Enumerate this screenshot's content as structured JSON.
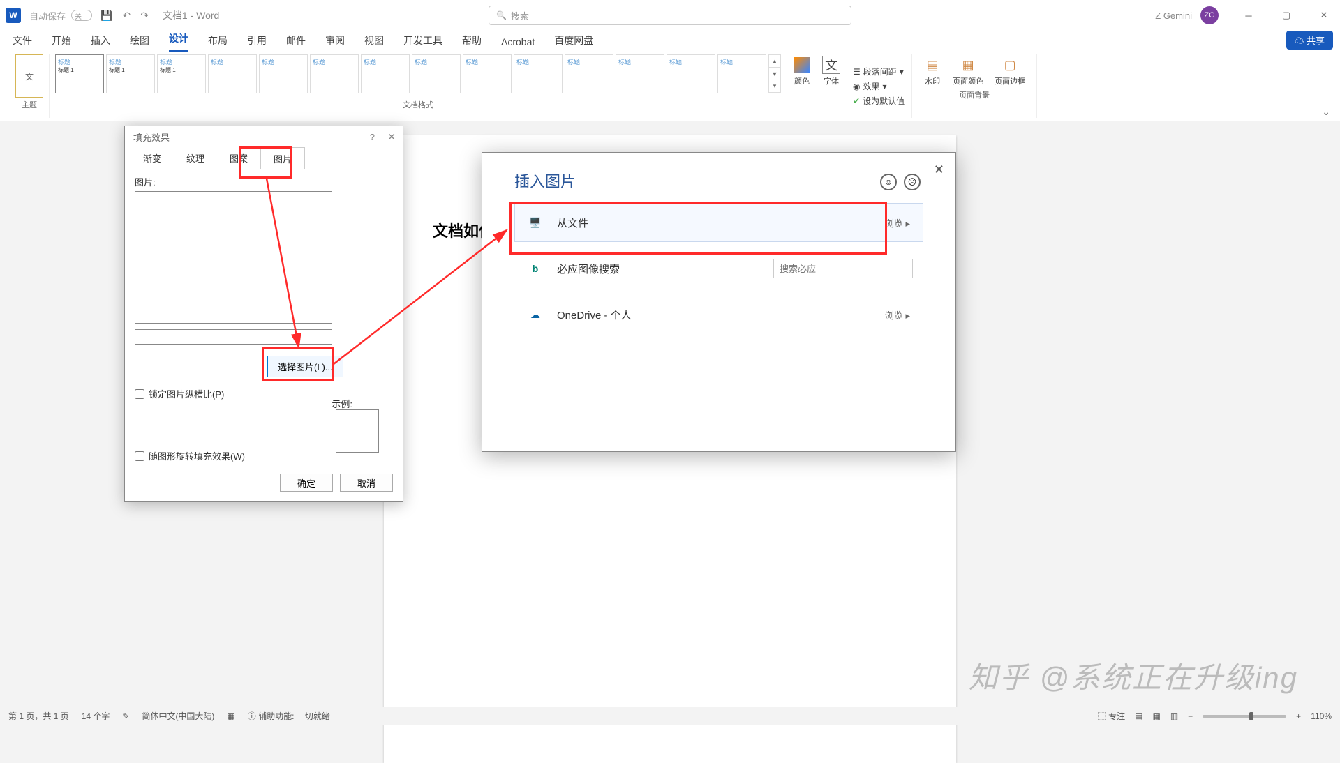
{
  "titlebar": {
    "autosave": "自动保存",
    "toggle": "关",
    "doc_title": "文档1 - Word",
    "search_placeholder": "搜索",
    "user_name": "Z Gemini",
    "user_initials": "ZG"
  },
  "tabs": [
    "文件",
    "开始",
    "插入",
    "绘图",
    "设计",
    "布局",
    "引用",
    "邮件",
    "审阅",
    "视图",
    "开发工具",
    "帮助",
    "Acrobat",
    "百度网盘"
  ],
  "active_tab": "设计",
  "share_label": "共享",
  "ribbon": {
    "themes": "主题",
    "style_label_main": "标题",
    "style_label_sub": "标题 1",
    "group_docformat": "文档格式",
    "colors": "颜色",
    "fonts": "字体",
    "para_spacing": "段落间距",
    "effects": "效果",
    "set_default": "设为默认值",
    "watermark": "水印",
    "page_color": "页面颜色",
    "page_border": "页面边框",
    "group_bg": "页面背景"
  },
  "document_heading": "文档如何",
  "fill_dialog": {
    "title": "填充效果",
    "tabs": [
      "渐变",
      "纹理",
      "图案",
      "图片"
    ],
    "active_tab": "图片",
    "picture_label": "图片:",
    "select_btn": "选择图片(L)...",
    "lock_aspect": "锁定图片纵横比(P)",
    "sample_label": "示例:",
    "rotate_fill": "随图形旋转填充效果(W)",
    "ok": "确定",
    "cancel": "取消"
  },
  "insert_dialog": {
    "title": "插入图片",
    "from_file": "从文件",
    "browse": "浏览",
    "bing": "必应图像搜索",
    "bing_placeholder": "搜索必应",
    "onedrive": "OneDrive - 个人"
  },
  "statusbar": {
    "page": "第 1 页，共 1 页",
    "words": "14 个字",
    "lang": "简体中文(中国大陆)",
    "a11y": "辅助功能: 一切就绪",
    "focus": "专注",
    "zoom": "110%"
  },
  "watermark_text": "知乎 @系统正在升级ing"
}
